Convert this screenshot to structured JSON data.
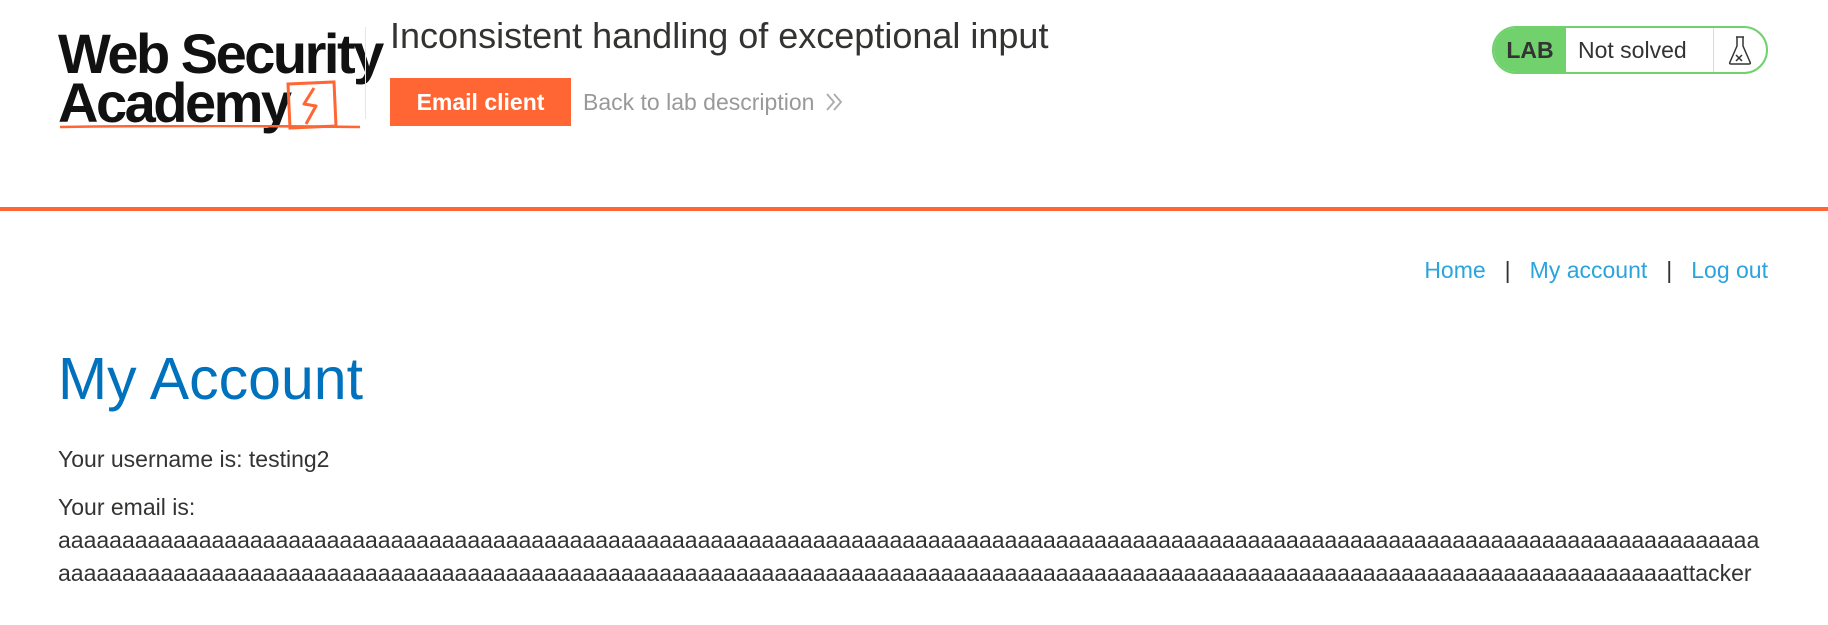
{
  "header": {
    "logo": {
      "line1": "Web Security",
      "line2": "Academy"
    },
    "lab_title": "Inconsistent handling of exceptional input",
    "email_client_label": "Email client",
    "back_link_label": "Back to lab description",
    "lab_badge": "LAB",
    "lab_status": "Not solved",
    "colors": {
      "accent": "#ff6633",
      "lab_green": "#70d16d"
    }
  },
  "nav": {
    "home": "Home",
    "separator": "|",
    "my_account": "My account",
    "log_out": "Log out"
  },
  "main": {
    "title": "My Account",
    "username_line": "Your username is: testing2",
    "email_label": "Your email is:",
    "email_line1": "aaaaaaaaaaaaaaaaaaaaaaaaaaaaaaaaaaaaaaaaaaaaaaaaaaaaaaaaaaaaaaaaaaaaaaaaaaaaaaaaaaaaaaaaaaaaaaaaaaaaaaaaaaaaaaaaaaaaaaaaaaaaaaaaaaaaa",
    "email_line2": "aaaaaaaaaaaaaaaaaaaaaaaaaaaaaaaaaaaaaaaaaaaaaaaaaaaaaaaaaaaaaaaaaaaaaaaaaaaaaaaaaaaaaaaaaaaaaaaaaaaaaaaaaaaaaaaaaaaaaaaaaaaaaaattacker"
  }
}
